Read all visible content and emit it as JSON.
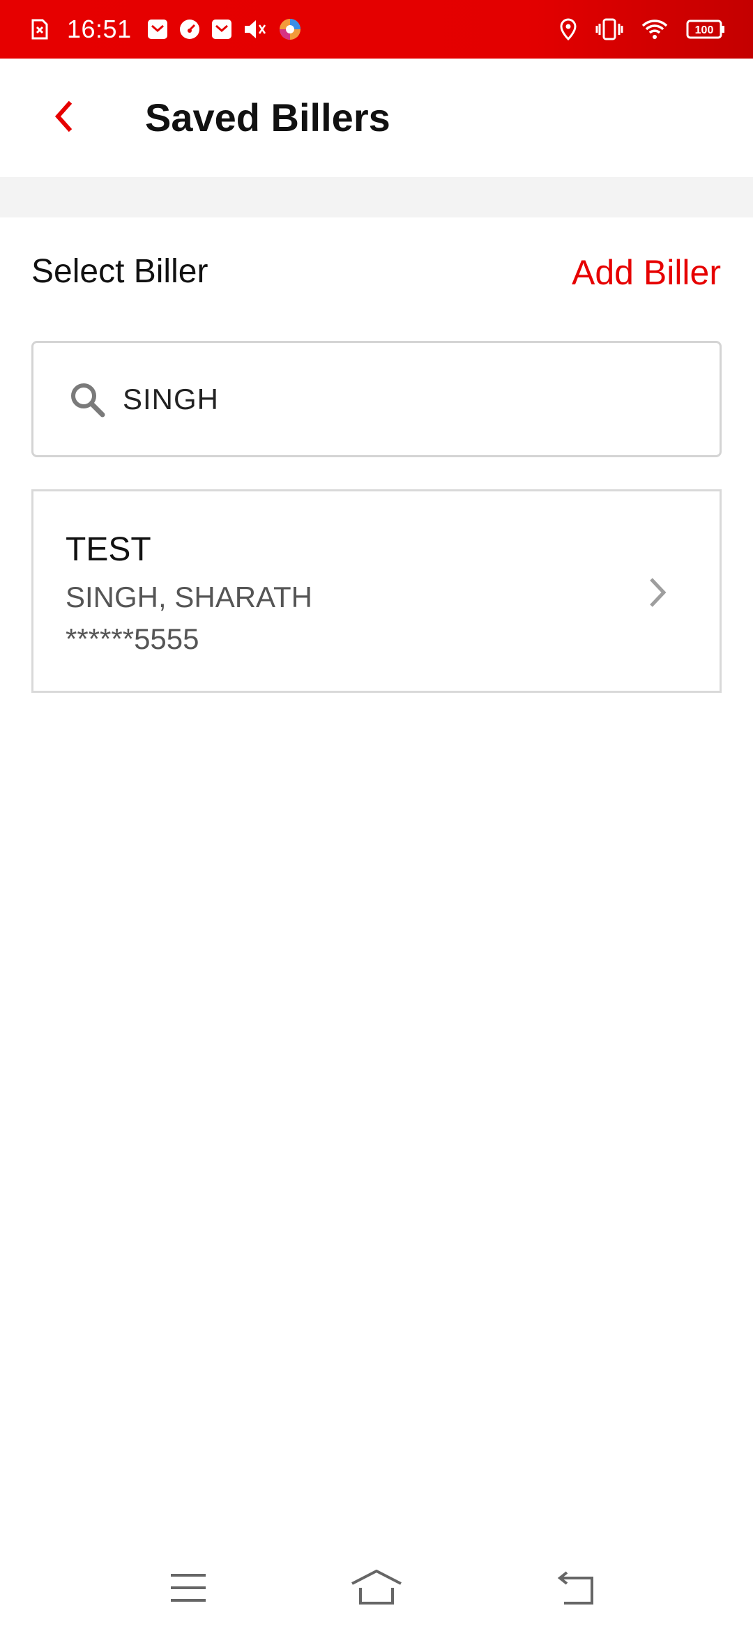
{
  "status_bar": {
    "time": "16:51",
    "battery": "100",
    "icons_left": [
      "sim-error-icon",
      "mail-icon",
      "speed-icon",
      "mail-icon",
      "mute-icon",
      "browser-icon"
    ],
    "icons_right": [
      "location-icon",
      "vibrate-icon",
      "wifi-icon",
      "battery-icon"
    ]
  },
  "app_bar": {
    "title": "Saved Billers",
    "back_icon": "chevron-left-icon"
  },
  "section": {
    "label": "Select Biller",
    "add_label": "Add Biller"
  },
  "search": {
    "value": "SINGH",
    "icon": "search-icon"
  },
  "billers": [
    {
      "name": "TEST",
      "customer": "SINGH, SHARATH",
      "account": "******5555"
    }
  ],
  "nav_bar": {
    "icons": [
      "menu-icon",
      "home-icon",
      "back-icon"
    ]
  },
  "colors": {
    "accent": "#e60000",
    "status_bar": "#e60000",
    "divider_band": "#f3f3f3",
    "border": "#d4d4d4"
  }
}
